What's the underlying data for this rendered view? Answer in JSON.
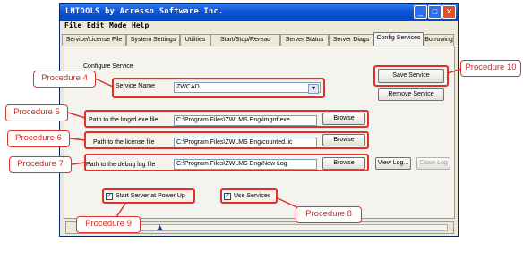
{
  "window": {
    "title": "LMTOOLS by Acresso Software Inc.",
    "min_glyph": "_",
    "max_glyph": "□",
    "close_glyph": "✕"
  },
  "menu": {
    "items": [
      "File",
      "Edit",
      "Mode",
      "Help"
    ]
  },
  "tabs": [
    {
      "label": "Service/License File"
    },
    {
      "label": "System Settings"
    },
    {
      "label": "Utilities"
    },
    {
      "label": "Start/Stop/Reread"
    },
    {
      "label": "Server Status"
    },
    {
      "label": "Server Diags"
    },
    {
      "label": "Config Services",
      "active": true
    },
    {
      "label": "Borrowing"
    }
  ],
  "config": {
    "group_label": "Configure Service",
    "service_name_label": "Service Name",
    "service_name_value": "ZWCAD",
    "lmgrd_label": "Path to the lmgrd.exe file",
    "lmgrd_value": "C:\\Program Files\\ZWLMS Eng\\lmgrd.exe",
    "license_label": "Path to the license file",
    "license_value": "C:\\Program Files\\ZWLMS Eng\\counted.lic",
    "debug_label": "Path to the debug log file",
    "debug_value": "C:\\Program Files\\ZWLMS Eng\\New Log",
    "browse_label": "Browse",
    "save_label": "Save Service",
    "remove_label": "Remove Service",
    "view_log_label": "View Log...",
    "close_log_label": "Close Log",
    "start_server_label": "Start Server at Power Up",
    "use_services_label": "Use Services",
    "check_glyph": "✓",
    "dropdown_glyph": "▾"
  },
  "callouts": {
    "p4": "Procedure 4",
    "p5": "Procedure 5",
    "p6": "Procedure 6",
    "p7": "Procedure 7",
    "p8": "Procedure 8",
    "p9": "Procedure 9",
    "p10": "Procedure 10"
  },
  "colors": {
    "annotation": "#e0302a",
    "titlebar": "#0a55d8",
    "marker": "#1a3f8c"
  },
  "icons": [
    "minimize-icon",
    "maximize-icon",
    "close-icon",
    "chevron-down-icon",
    "triangle-up-icon"
  ]
}
